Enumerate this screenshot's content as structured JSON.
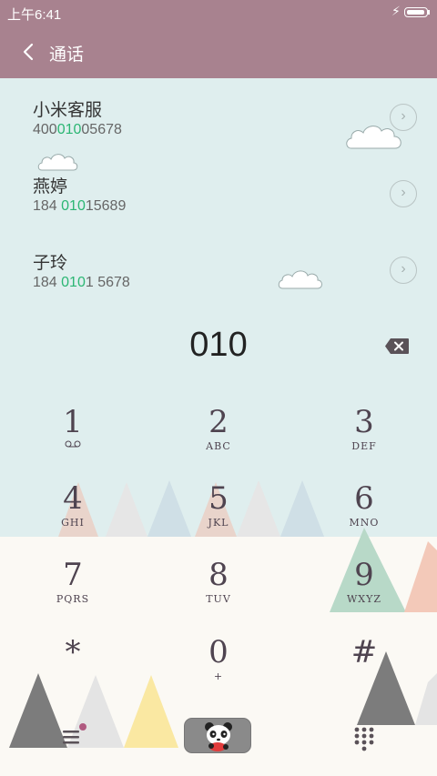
{
  "status_bar": {
    "time": "上午6:41"
  },
  "header": {
    "title": "通话"
  },
  "contacts": [
    {
      "name": "小米客服",
      "number_before": "400",
      "number_match": "010",
      "number_after": "05678"
    },
    {
      "name": "燕婷",
      "number_before": "184 ",
      "number_match": "010",
      "number_after": "15689"
    },
    {
      "name": "子玲",
      "number_before": "184 ",
      "number_match": "010",
      "number_after": "1 5678"
    }
  ],
  "dialed_number": "010",
  "keypad": [
    {
      "digit": "1",
      "letters": ""
    },
    {
      "digit": "2",
      "letters": "ABC"
    },
    {
      "digit": "3",
      "letters": "DEF"
    },
    {
      "digit": "4",
      "letters": "GHI"
    },
    {
      "digit": "5",
      "letters": "JKL"
    },
    {
      "digit": "6",
      "letters": "MNO"
    },
    {
      "digit": "7",
      "letters": "PQRS"
    },
    {
      "digit": "8",
      "letters": "TUV"
    },
    {
      "digit": "9",
      "letters": "WXYZ"
    },
    {
      "digit": "*",
      "letters": ""
    },
    {
      "digit": "0",
      "letters": "+"
    },
    {
      "digit": "#",
      "letters": ""
    }
  ],
  "colors": {
    "header": "#a8828f",
    "background_top": "#dfeeee",
    "background_bottom": "#fbf9f4",
    "match_highlight": "#2bb673",
    "menu_badge": "#b05a80"
  },
  "icons": {
    "back": "chevron-left-icon",
    "contact_detail": "chevron-right-icon",
    "backspace": "backspace-icon",
    "voicemail": "voicemail-icon",
    "menu": "menu-icon",
    "panda": "panda-icon",
    "dialpad": "dialpad-icon"
  }
}
